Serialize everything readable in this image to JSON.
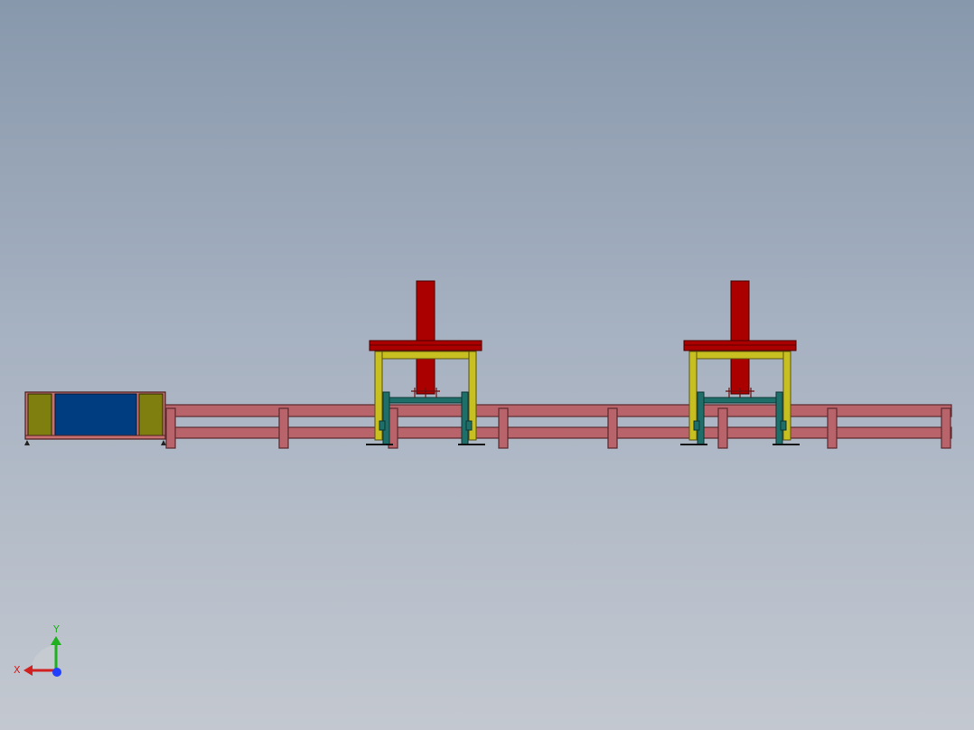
{
  "viewport": {
    "background_top": "#8898ac",
    "background_bottom": "#c3c8d0"
  },
  "colors": {
    "conveyor": "#b8646a",
    "conveyor_edge": "#5a2a2e",
    "gantry_frame": "#c8c020",
    "gantry_frame_edge": "#5a5410",
    "actuator": "#aa0000",
    "actuator_edge": "#4a0000",
    "carriage": "#1e6f6a",
    "carriage_edge": "#0d3433",
    "cabinet_side_panel": "#7f7f10",
    "cabinet_center_panel": "#003c80",
    "cabinet_frame": "#c87070"
  },
  "triad": {
    "x_label": "X",
    "y_label": "Y",
    "x_color": "#d02020",
    "y_color": "#20b020",
    "z_color": "#2040ff"
  },
  "model": {
    "components": [
      {
        "name": "feed-cabinet",
        "icon": "cabinet"
      },
      {
        "name": "roller-conveyor",
        "icon": "conveyor"
      },
      {
        "name": "gantry-station-1",
        "icon": "gantry"
      },
      {
        "name": "gantry-station-2",
        "icon": "gantry"
      }
    ]
  }
}
